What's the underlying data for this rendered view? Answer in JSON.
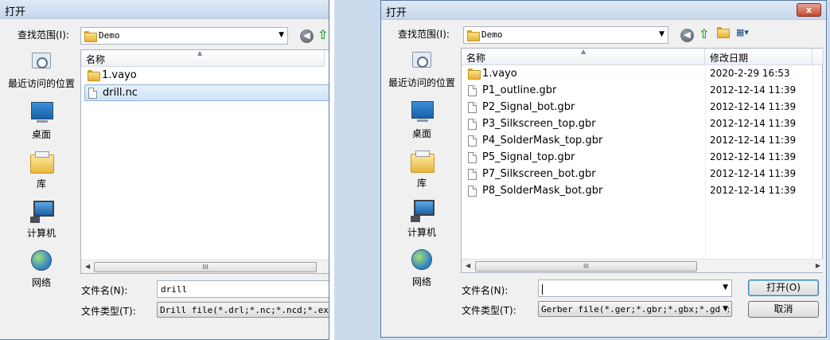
{
  "left_dialog": {
    "title": "打开",
    "look_in_label": "查找范围(I):",
    "look_in_value": "Demo",
    "places": [
      {
        "label": "最近访问的位置",
        "icon": "recent-places-icon"
      },
      {
        "label": "桌面",
        "icon": "desktop-icon"
      },
      {
        "label": "库",
        "icon": "libraries-icon"
      },
      {
        "label": "计算机",
        "icon": "computer-icon"
      },
      {
        "label": "网络",
        "icon": "network-icon"
      }
    ],
    "columns": {
      "name": "名称"
    },
    "files": [
      {
        "name": "1.vayo",
        "type": "folder",
        "selected": false
      },
      {
        "name": "drill.nc",
        "type": "file",
        "selected": true
      }
    ],
    "filename_label": "文件名(N):",
    "filename_value": "drill",
    "filetype_label": "文件类型(T):",
    "filetype_value": "Drill file(*.drl;*.nc;*.ncd;*.exc)"
  },
  "right_dialog": {
    "title": "打开",
    "close_label": "x",
    "look_in_label": "查找范围(I):",
    "look_in_value": "Demo",
    "places": [
      {
        "label": "最近访问的位置",
        "icon": "recent-places-icon"
      },
      {
        "label": "桌面",
        "icon": "desktop-icon"
      },
      {
        "label": "库",
        "icon": "libraries-icon"
      },
      {
        "label": "计算机",
        "icon": "computer-icon"
      },
      {
        "label": "网络",
        "icon": "network-icon"
      }
    ],
    "columns": {
      "name": "名称",
      "modified": "修改日期"
    },
    "files": [
      {
        "name": "1.vayo",
        "date": "2020-2-29 16:53",
        "type": "folder"
      },
      {
        "name": "P1_outline.gbr",
        "date": "2012-12-14 11:39",
        "type": "file"
      },
      {
        "name": "P2_Signal_bot.gbr",
        "date": "2012-12-14 11:39",
        "type": "file"
      },
      {
        "name": "P3_Silkscreen_top.gbr",
        "date": "2012-12-14 11:39",
        "type": "file"
      },
      {
        "name": "P4_SolderMask_top.gbr",
        "date": "2012-12-14 11:39",
        "type": "file"
      },
      {
        "name": "P5_Signal_top.gbr",
        "date": "2012-12-14 11:39",
        "type": "file"
      },
      {
        "name": "P7_Silkscreen_bot.gbr",
        "date": "2012-12-14 11:39",
        "type": "file"
      },
      {
        "name": "P8_SolderMask_bot.gbr",
        "date": "2012-12-14 11:39",
        "type": "file"
      }
    ],
    "filename_label": "文件名(N):",
    "filename_value": "",
    "filetype_label": "文件类型(T):",
    "filetype_value": "Gerber file(*.ger;*.gbr;*.gbx;*.gdo;*",
    "open_button": "打开(O)",
    "cancel_button": "取消"
  },
  "scroll_grip": "III"
}
